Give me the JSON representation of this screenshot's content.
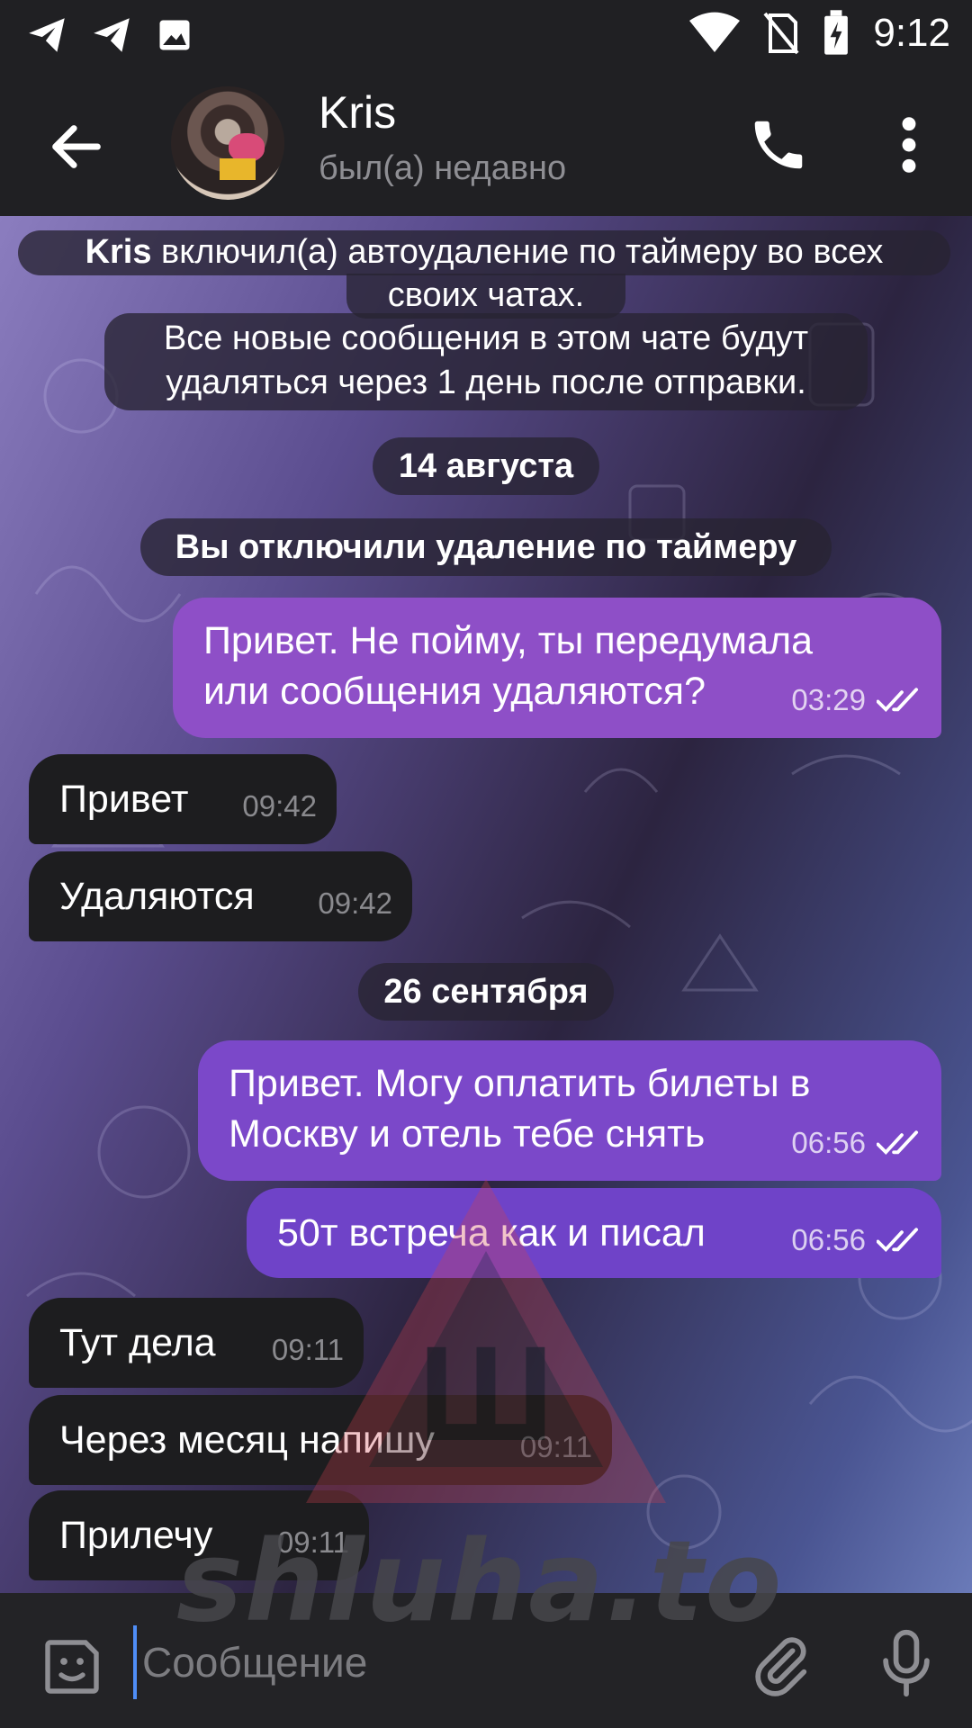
{
  "status_bar": {
    "time": "9:12",
    "left_icons": [
      "telegram-icon",
      "telegram-icon",
      "image-icon"
    ],
    "right_icons": [
      "wifi-icon",
      "no-sim-icon",
      "battery-charging-icon"
    ]
  },
  "header": {
    "name": "Kris",
    "status": "был(а) недавно",
    "icons": [
      "back-arrow-icon",
      "phone-icon",
      "more-vert-icon"
    ]
  },
  "service": {
    "autodelete_name": "Kris",
    "autodelete_line1": " включил(а) автоудаление по таймеру во всех",
    "autodelete_line2": "своих чатах.",
    "autodelete_line3": "Все новые сообщения в этом чате будут",
    "autodelete_line4": "удаляться через 1 день после отправки.",
    "date1": "14 августа",
    "disabled": "Вы отключили удаление по таймеру",
    "date2": "26 сентября"
  },
  "messages": [
    {
      "dir": "out",
      "line1": "Привет. Не пойму, ты передумала",
      "line2": "или сообщения удаляются?",
      "time": "03:29",
      "read": true
    },
    {
      "dir": "in",
      "text": "Привет",
      "time": "09:42"
    },
    {
      "dir": "in",
      "text": "Удаляются",
      "time": "09:42"
    },
    {
      "dir": "out",
      "line1": "Привет. Могу оплатить билеты в",
      "line2": "Москву и отель тебе снять",
      "time": "06:56",
      "read": true
    },
    {
      "dir": "out",
      "text": "50т встреча как и писал",
      "time": "06:56",
      "read": true
    },
    {
      "dir": "in",
      "text": "Тут дела",
      "time": "09:11"
    },
    {
      "dir": "in",
      "text": "Через месяц напишу",
      "time": "09:11"
    },
    {
      "dir": "in",
      "text": "Прилечу",
      "time": "09:11"
    }
  ],
  "input": {
    "placeholder": "Сообщение",
    "icons": [
      "sticker-icon",
      "attach-icon",
      "mic-icon"
    ]
  },
  "watermark": {
    "letter": "Ш",
    "text": "shluha.to"
  },
  "colors": {
    "outgoing_bubble": "#8e4fc7",
    "outgoing_bubble_alt": "#6f43c8",
    "incoming_bubble": "#1d1d1f",
    "bar_bg": "#202023",
    "cursor": "#4f8ef7"
  }
}
